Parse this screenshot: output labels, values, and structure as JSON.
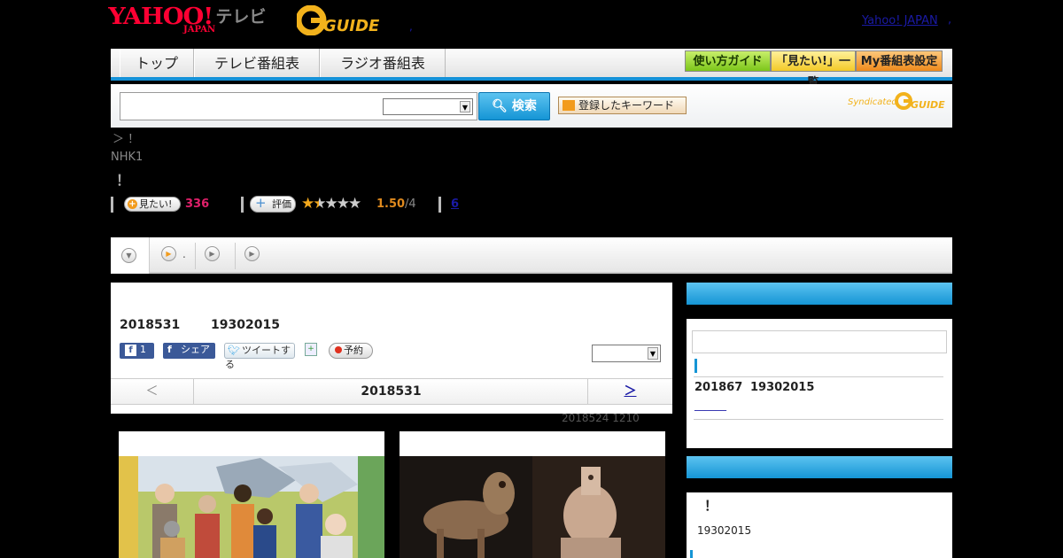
{
  "header": {
    "logo_yahoo": "YAHOO!",
    "logo_japan": "JAPAN",
    "logo_tv": "テレビ",
    "gguide_logo": "G GUIDE",
    "yahoo_japan_link": "Yahoo! JAPAN",
    "dot1": ",",
    "dot2": ","
  },
  "nav": {
    "tabs": [
      "トップ",
      "テレビ番組表",
      "ラジオ番組表"
    ],
    "guide_buttons": [
      "使い方ガイド",
      "「見たい!」一覧",
      "My番組表設定"
    ]
  },
  "search": {
    "input_value": "",
    "select_value": "",
    "search_button": "検索",
    "keyword_button": "登録したキーワード",
    "syndicated": "Syndicated",
    "syndicated_logo": "G GUIDE"
  },
  "program": {
    "breadcrumb": "＞ ！",
    "channel": "NHK1",
    "title": "！",
    "mitai_label": "見たい!",
    "mitai_count": "336",
    "hyouka_label": "評価",
    "rating_value": "1.50",
    "rating_max": "/4",
    "comment_count": "6",
    "stars": 1.5
  },
  "tabbar": {
    "tab2_text": "."
  },
  "main": {
    "date": "2018531",
    "time": "19302015",
    "fb_count": "1",
    "share_label": "シェア",
    "tweet_label": "ツイートする",
    "reserve_label": "予約",
    "pager_prev": "＜",
    "pager_date": "2018531",
    "pager_next": "＞",
    "update_note": "2018524  1210"
  },
  "sidebar": {
    "box1_date": "201867",
    "box1_time": "19302015",
    "box1_link": "______",
    "box2_title": "！",
    "box2_time": "19302015"
  },
  "colors": {
    "accent_blue": "#1592d8",
    "pink_count": "#e0206a",
    "rating_orange": "#e08a1e"
  }
}
